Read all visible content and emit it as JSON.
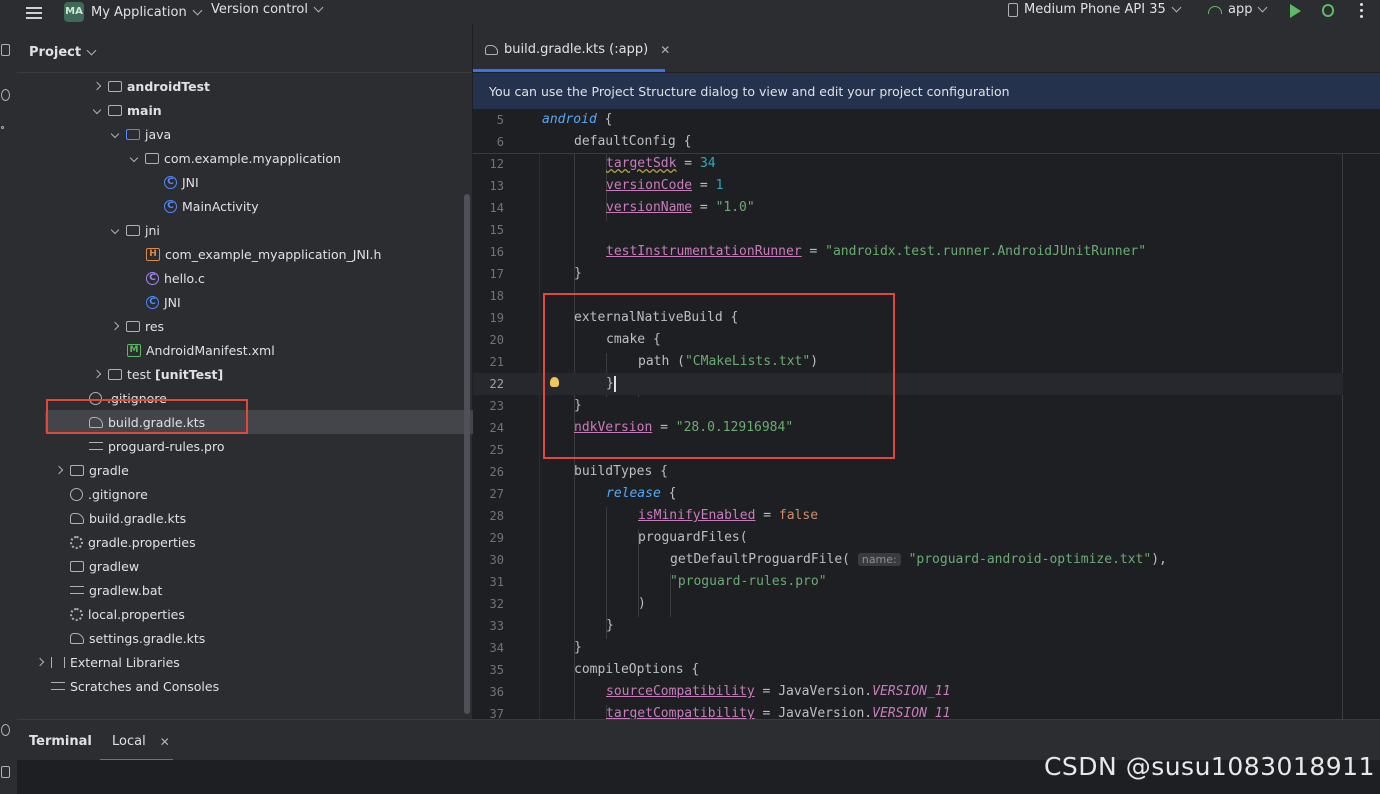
{
  "topbar": {
    "project_badge": "MA",
    "project_name": "My Application",
    "vcs": "Version control",
    "device": "Medium Phone API 35",
    "run_config": "app"
  },
  "project_panel": {
    "title": "Project",
    "tree": [
      {
        "label": "androidTest",
        "bold": true
      },
      {
        "label": "main",
        "bold": true
      },
      {
        "label": "java"
      },
      {
        "label": "com.example.myapplication"
      },
      {
        "label": "JNI"
      },
      {
        "label": "MainActivity"
      },
      {
        "label": "jni"
      },
      {
        "label": "com_example_myapplication_JNI.h"
      },
      {
        "label": "hello.c"
      },
      {
        "label": "JNI"
      },
      {
        "label": "res"
      },
      {
        "label": "AndroidManifest.xml"
      },
      {
        "label": "test",
        "suffix": "[unitTest]"
      },
      {
        "label": ".gitignore"
      },
      {
        "label": "build.gradle.kts",
        "selected": true
      },
      {
        "label": "proguard-rules.pro"
      },
      {
        "label": "gradle"
      },
      {
        "label": ".gitignore"
      },
      {
        "label": "build.gradle.kts"
      },
      {
        "label": "gradle.properties"
      },
      {
        "label": "gradlew"
      },
      {
        "label": "gradlew.bat"
      },
      {
        "label": "local.properties"
      },
      {
        "label": "settings.gradle.kts"
      },
      {
        "label": "External Libraries"
      },
      {
        "label": "Scratches and Consoles"
      }
    ]
  },
  "editor": {
    "tab_label": "build.gradle.kts (:app)",
    "banner": "You can use the Project Structure dialog to view and edit your project configuration",
    "sticky": [
      {
        "n": "5",
        "text": "android {"
      },
      {
        "n": "6",
        "text": "defaultConfig {"
      }
    ],
    "lines": [
      {
        "n": "12",
        "text": "targetSdk = 34"
      },
      {
        "n": "13",
        "text": "versionCode = 1"
      },
      {
        "n": "14",
        "text": "versionName = \"1.0\""
      },
      {
        "n": "15",
        "text": ""
      },
      {
        "n": "16",
        "text": "testInstrumentationRunner = \"androidx.test.runner.AndroidJUnitRunner\""
      },
      {
        "n": "17",
        "text": "}"
      },
      {
        "n": "18",
        "text": ""
      },
      {
        "n": "19",
        "text": "externalNativeBuild {"
      },
      {
        "n": "20",
        "text": "cmake {"
      },
      {
        "n": "21",
        "text": "path (\"CMakeLists.txt\")"
      },
      {
        "n": "22",
        "text": "}"
      },
      {
        "n": "23",
        "text": "}"
      },
      {
        "n": "24",
        "text": "ndkVersion = \"28.0.12916984\""
      },
      {
        "n": "25",
        "text": ""
      },
      {
        "n": "26",
        "text": "buildTypes {"
      },
      {
        "n": "27",
        "text": "release {"
      },
      {
        "n": "28",
        "text": "isMinifyEnabled = false"
      },
      {
        "n": "29",
        "text": "proguardFiles("
      },
      {
        "n": "30",
        "text": "getDefaultProguardFile( name: \"proguard-android-optimize.txt\"),"
      },
      {
        "n": "31",
        "text": "\"proguard-rules.pro\""
      },
      {
        "n": "32",
        "text": ")"
      },
      {
        "n": "33",
        "text": "}"
      },
      {
        "n": "34",
        "text": "}"
      },
      {
        "n": "35",
        "text": "compileOptions {"
      },
      {
        "n": "36",
        "text": "sourceCompatibility = JavaVersion.VERSION_11"
      },
      {
        "n": "37",
        "text": "targetCompatibility = JavaVersion.VERSION_11"
      }
    ],
    "param_hint": "name:"
  },
  "terminal": {
    "title": "Terminal",
    "tab": "Local"
  },
  "watermark": "CSDN @susu1083018911",
  "colors": {
    "accent": "#3574f0",
    "highlight_box": "#e0483b",
    "run_green": "#5fb865"
  }
}
